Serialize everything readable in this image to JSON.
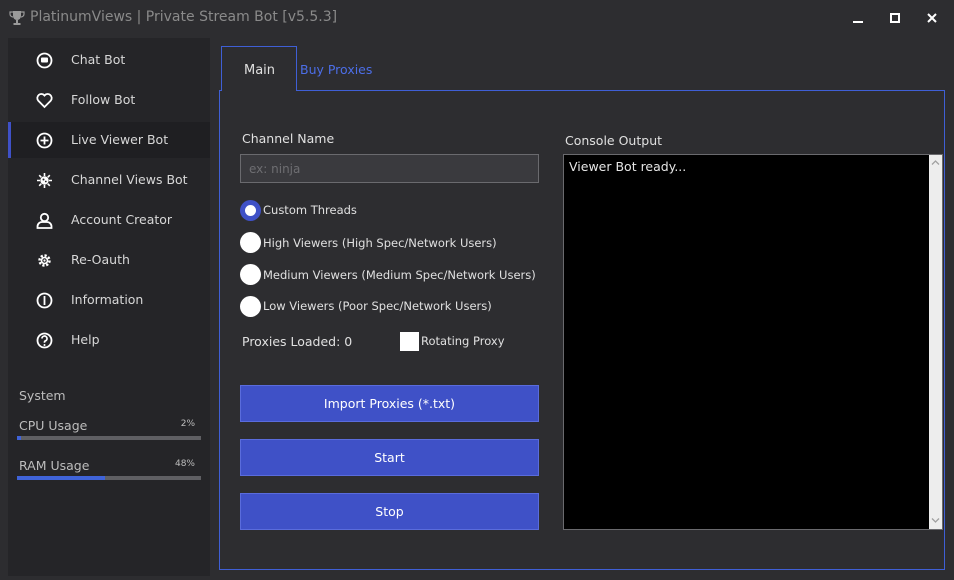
{
  "window": {
    "title": "PlatinumViews | Private Stream Bot [v5.5.3]",
    "controls": [
      "minimize",
      "maximize",
      "close"
    ]
  },
  "sidebar": {
    "items": [
      {
        "label": "Chat Bot",
        "icon": "chat-icon",
        "active": false
      },
      {
        "label": "Follow Bot",
        "icon": "heart-icon",
        "active": false
      },
      {
        "label": "Live Viewer Bot",
        "icon": "crosshair-icon",
        "active": true
      },
      {
        "label": "Channel Views Bot",
        "icon": "virus-icon",
        "active": false
      },
      {
        "label": "Account Creator",
        "icon": "user-icon",
        "active": false
      },
      {
        "label": "Re-Oauth",
        "icon": "gear-icon",
        "active": false
      },
      {
        "label": "Information",
        "icon": "info-icon",
        "active": false
      },
      {
        "label": "Help",
        "icon": "help-icon",
        "active": false
      }
    ],
    "system": {
      "title": "System",
      "cpu": {
        "label": "CPU Usage",
        "percent_text": "2%",
        "fraction": 0.02
      },
      "ram": {
        "label": "RAM Usage",
        "percent_text": "48%",
        "fraction": 0.48
      }
    }
  },
  "tabs": {
    "main": "Main",
    "buy": "Buy Proxies"
  },
  "form": {
    "channel_label": "Channel Name",
    "channel_placeholder": "ex: ninja",
    "channel_value": "",
    "radios": [
      {
        "label": "Custom Threads",
        "checked": true
      },
      {
        "label": "High Viewers (High Spec/Network Users)",
        "checked": false
      },
      {
        "label": "Medium Viewers (Medium Spec/Network Users)",
        "checked": false
      },
      {
        "label": "Low Viewers (Poor Spec/Network Users)",
        "checked": false
      }
    ],
    "proxies_loaded": "Proxies Loaded: 0",
    "rotating_proxy_label": "Rotating Proxy",
    "rotating_proxy_checked": false,
    "import_button": "Import Proxies (*.txt)",
    "start_button": "Start",
    "stop_button": "Stop"
  },
  "console": {
    "label": "Console Output",
    "text": "Viewer Bot ready..."
  },
  "colors": {
    "accent": "#3f51c7",
    "link": "#4c6ee8",
    "border": "#3f5fd6",
    "background": "#2d2d30",
    "sidebar": "#252528"
  }
}
